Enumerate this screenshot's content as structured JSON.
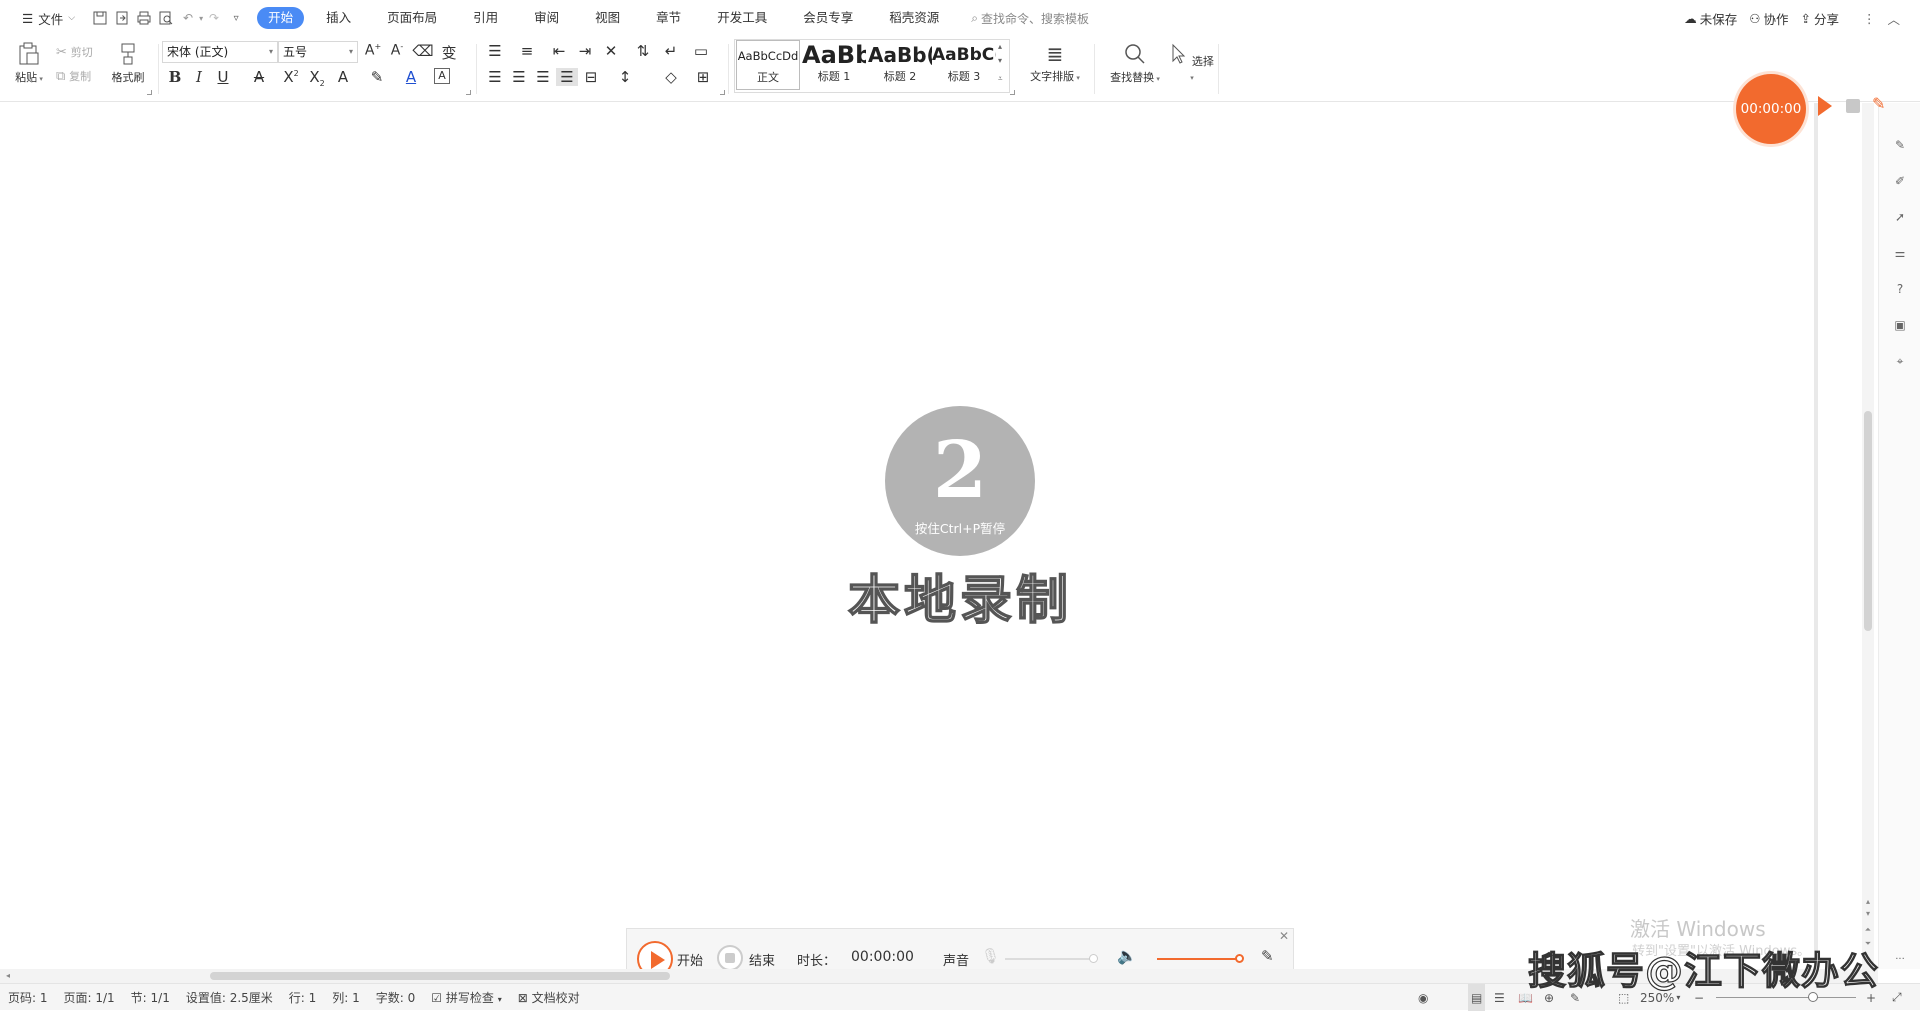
{
  "menubar": {
    "file_label": "文件",
    "tabs": [
      "开始",
      "插入",
      "页面布局",
      "引用",
      "审阅",
      "视图",
      "章节",
      "开发工具",
      "会员专享",
      "稻壳资源"
    ],
    "search_placeholder": "查找命令、搜索模板",
    "unsaved": "未保存",
    "collaborate": "协作",
    "share": "分享"
  },
  "ribbon": {
    "paste": "粘贴",
    "cut": "剪切",
    "copy": "复制",
    "format_painter": "格式刷",
    "font_name": "宋体 (正文)",
    "font_size": "五号",
    "styles": [
      {
        "sample": "AaBbCcDd",
        "name": "正文"
      },
      {
        "sample": "AaBb",
        "name": "标题 1"
      },
      {
        "sample": "AaBb(",
        "name": "标题 2"
      },
      {
        "sample": "AaBbC(",
        "name": "标题 3"
      }
    ],
    "text_layout": "文字排版",
    "find_replace": "查找替换",
    "select": "选择"
  },
  "recorder": {
    "float_time": "00:00:00",
    "countdown": "2",
    "countdown_hint": "按住Ctrl+P暂停",
    "title": "本地录制",
    "start": "开始",
    "end": "结束",
    "duration_label": "时长：",
    "duration": "00:00:00",
    "sound": "声音",
    "accent": "#f26a2e"
  },
  "statusbar": {
    "page_code": "页码: 1",
    "pages": "页面: 1/1",
    "section": "节: 1/1",
    "setting": "设置值: 2.5厘米",
    "row": "行: 1",
    "col": "列: 1",
    "words": "字数: 0",
    "spell": "拼写检查",
    "proof": "文档校对",
    "zoom": "250%"
  },
  "watermark": {
    "activate_line1": "激活 Windows",
    "activate_line2": "转到\"设置\"以激活 Windows。",
    "sohu": "搜狐号@江下微办公"
  }
}
